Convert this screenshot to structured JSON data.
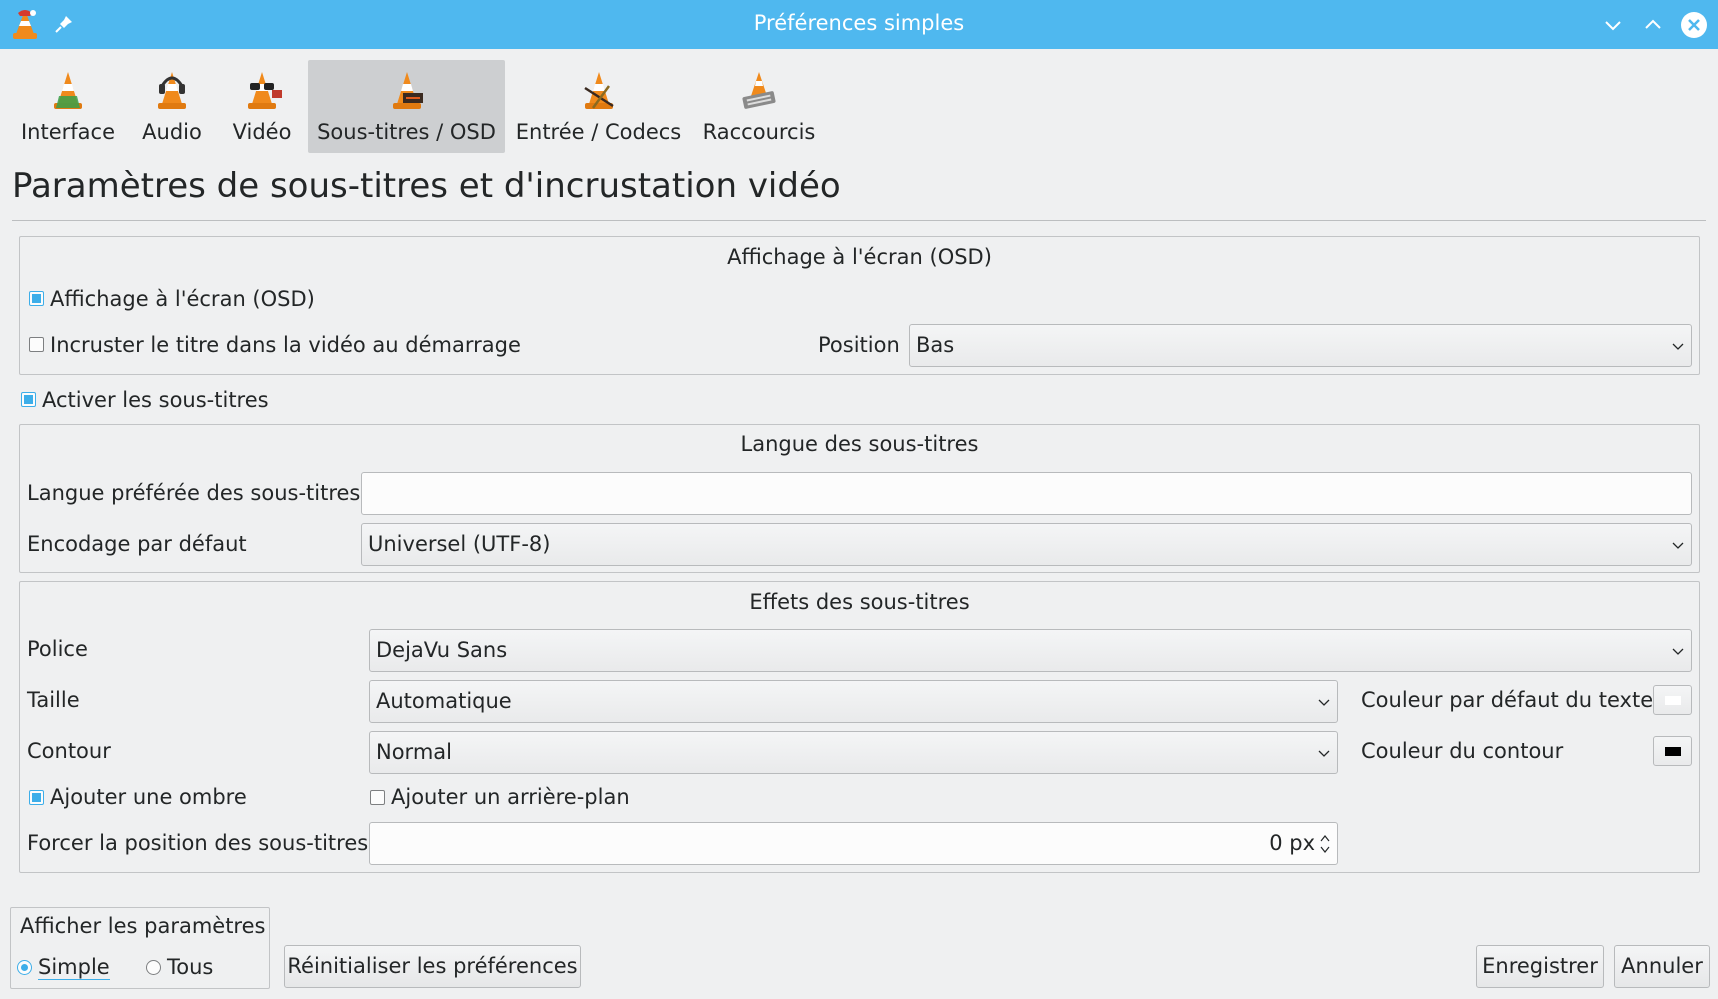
{
  "window": {
    "title": "Préférences simples"
  },
  "toolbar": {
    "items": [
      {
        "label": "Interface",
        "icon": "vlc-cone-interface-icon"
      },
      {
        "label": "Audio",
        "icon": "vlc-cone-headphones-icon"
      },
      {
        "label": "Vidéo",
        "icon": "vlc-cone-glasses-icon"
      },
      {
        "label": "Sous-titres / OSD",
        "icon": "vlc-cone-subtitles-icon"
      },
      {
        "label": "Entrée / Codecs",
        "icon": "vlc-cone-codecs-icon"
      },
      {
        "label": "Raccourcis",
        "icon": "vlc-cone-hotkeys-icon"
      }
    ],
    "active": "Sous-titres / OSD"
  },
  "page": {
    "title": "Paramètres de sous-titres et d'incrustation vidéo"
  },
  "osd": {
    "group_title": "Affichage à l'écran (OSD)",
    "enable_osd": {
      "label": "Affichage à l'écran (OSD)",
      "checked": true
    },
    "show_title": {
      "label": "Incruster le titre dans la vidéo au démarrage",
      "checked": false
    },
    "position_label": "Position",
    "position_value": "Bas"
  },
  "enable_subtitles": {
    "label": "Activer les sous-titres",
    "checked": true
  },
  "language": {
    "group_title": "Langue des sous-titres",
    "preferred_label": "Langue préférée des sous-titres",
    "preferred_value": "",
    "encoding_label": "Encodage par défaut",
    "encoding_value": "Universel (UTF-8)"
  },
  "effects": {
    "group_title": "Effets des sous-titres",
    "font_label": "Police",
    "font_value": "DejaVu Sans",
    "size_label": "Taille",
    "size_value": "Automatique",
    "outline_label": "Contour",
    "outline_value": "Normal",
    "text_color_label": "Couleur par défaut du texte",
    "text_color": "#ffffff",
    "outline_color_label": "Couleur du contour",
    "outline_color": "#000000",
    "shadow": {
      "label": "Ajouter une ombre",
      "checked": true
    },
    "background": {
      "label": "Ajouter un arrière-plan",
      "checked": false
    },
    "force_position_label": "Forcer la position des sous-titres",
    "force_position_value": "0 px"
  },
  "show_settings": {
    "label": "Afficher les paramètres",
    "simple": "Simple",
    "all": "Tous",
    "selected": "Simple"
  },
  "buttons": {
    "reset": "Réinitialiser les préférences",
    "save": "Enregistrer",
    "cancel": "Annuler"
  },
  "colors": {
    "titlebar": "#4fb8ef",
    "accent": "#3daee9",
    "background": "#eff0f1"
  }
}
